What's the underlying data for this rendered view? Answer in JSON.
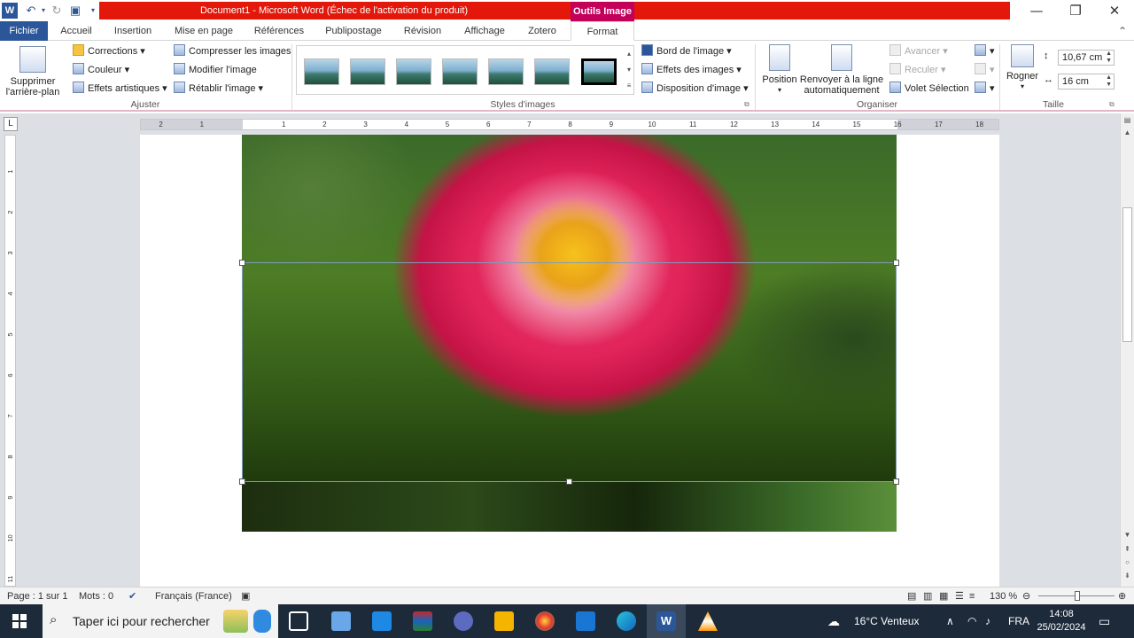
{
  "window": {
    "title": "Document1  -  Microsoft Word (Échec de l'activation du produit)",
    "contextual_tab": "Outils Image",
    "minimize": "—",
    "restore": "❐",
    "close": "✕"
  },
  "tabs": [
    {
      "label": "Fichier"
    },
    {
      "label": "Accueil"
    },
    {
      "label": "Insertion"
    },
    {
      "label": "Mise en page"
    },
    {
      "label": "Références"
    },
    {
      "label": "Publipostage"
    },
    {
      "label": "Révision"
    },
    {
      "label": "Affichage"
    },
    {
      "label": "Zotero"
    },
    {
      "label": "Format"
    }
  ],
  "ribbon": {
    "ajuster": {
      "label": "Ajuster",
      "remove_bg": "Supprimer\nl'arrière-plan",
      "corrections": "Corrections",
      "couleur": "Couleur",
      "effets_artistiques": "Effets artistiques",
      "compresser": "Compresser les images",
      "modifier": "Modifier l'image",
      "retablir": "Rétablir l'image"
    },
    "styles": {
      "label": "Styles d'images",
      "bord": "Bord de l'image",
      "effets": "Effets des images",
      "disposition": "Disposition d'image"
    },
    "organiser": {
      "label": "Organiser",
      "position": "Position",
      "renvoyer": "Renvoyer à la ligne\nautomatiquement",
      "avancer": "Avancer",
      "reculer": "Reculer",
      "volet": "Volet Sélection"
    },
    "taille": {
      "label": "Taille",
      "rogner": "Rogner",
      "height": "10,67 cm",
      "width": "16 cm"
    }
  },
  "ruler": {
    "h_numbers": [
      "2",
      "1",
      "1",
      "2",
      "3",
      "4",
      "5",
      "6",
      "7",
      "8",
      "9",
      "10",
      "11",
      "12",
      "13",
      "14",
      "15",
      "16",
      "17",
      "18"
    ],
    "v_numbers": [
      "1",
      "2",
      "3",
      "4",
      "5",
      "6",
      "7",
      "8",
      "9",
      "10",
      "11",
      "12",
      "13"
    ]
  },
  "statusbar": {
    "page": "Page : 1 sur 1",
    "words": "Mots : 0",
    "language": "Français (France)",
    "zoom": "130 %",
    "zoom_level": 1.3
  },
  "taskbar": {
    "search_placeholder": "Taper ici pour rechercher",
    "weather": "16°C  Venteux",
    "lang": "FRA",
    "time": "14:08",
    "date": "25/02/2024"
  },
  "colors": {
    "title_bar": "#e3170a",
    "contextual": "#c3005a",
    "file_tab": "#2b579a"
  }
}
